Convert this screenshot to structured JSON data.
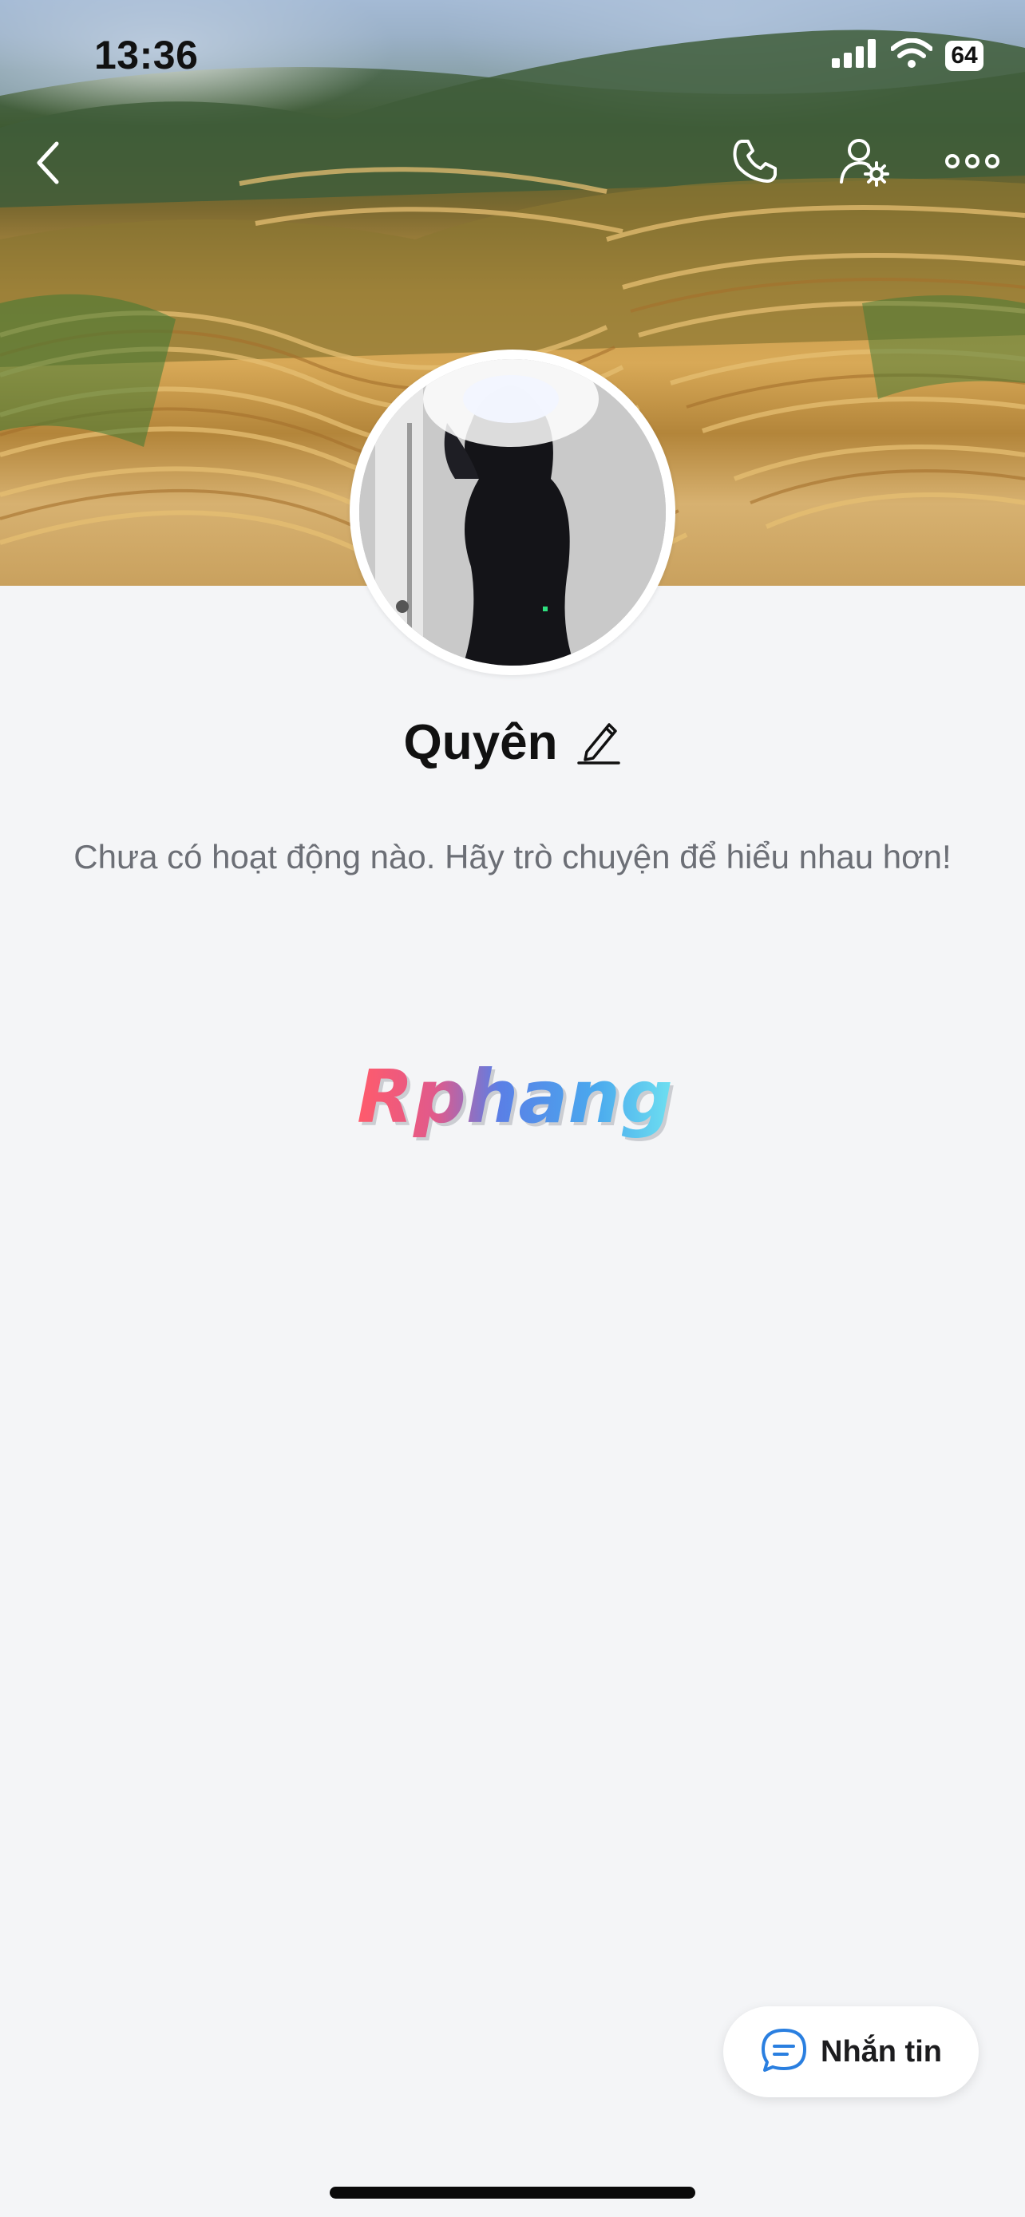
{
  "status_bar": {
    "time": "13:36",
    "battery": "64",
    "icons": [
      "signal-icon",
      "wifi-icon",
      "battery-icon"
    ]
  },
  "nav": {
    "icons": [
      "back-icon",
      "call-icon",
      "profile-settings-icon",
      "more-icon"
    ]
  },
  "profile": {
    "name": "Quyên",
    "empty_message": "Chưa có hoạt động nào. Hãy trò chuyện để hiểu nhau hơn!"
  },
  "watermark": {
    "text": "Rphang"
  },
  "actions": {
    "message_label": "Nhắn tin",
    "message_icon": "chat-bubble-icon"
  },
  "colors": {
    "accent": "#2a7fe0",
    "background": "#f4f5f7",
    "secondary_text": "#6c6f76"
  }
}
